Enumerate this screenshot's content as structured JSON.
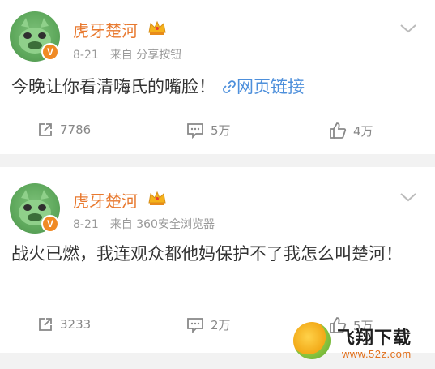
{
  "posts": [
    {
      "username": "虎牙楚河",
      "date": "8-21",
      "source": "来自 分享按钮",
      "verified_badge": "V",
      "content": "今晚让你看清嗨氏的嘴脸！",
      "link_label": "网页链接",
      "actions": {
        "share": "7786",
        "comment": "5万",
        "like": "4万"
      }
    },
    {
      "username": "虎牙楚河",
      "date": "8-21",
      "source": "来自 360安全浏览器",
      "verified_badge": "V",
      "content": "战火已燃，我连观众都他妈保护不了我怎么叫楚河！",
      "actions": {
        "share": "3233",
        "comment": "2万",
        "like": "5万"
      }
    }
  ],
  "watermark": {
    "title": "飞翔下载",
    "url": "www.52z.com"
  },
  "colors": {
    "username": "#e8792f",
    "link": "#4d8fdb",
    "meta": "#999999",
    "background": "#f2f2f2"
  },
  "icons": [
    "avatar-icon",
    "vip-crown-icon",
    "chevron-down-icon",
    "link-icon",
    "share-icon",
    "comment-icon",
    "like-icon"
  ]
}
